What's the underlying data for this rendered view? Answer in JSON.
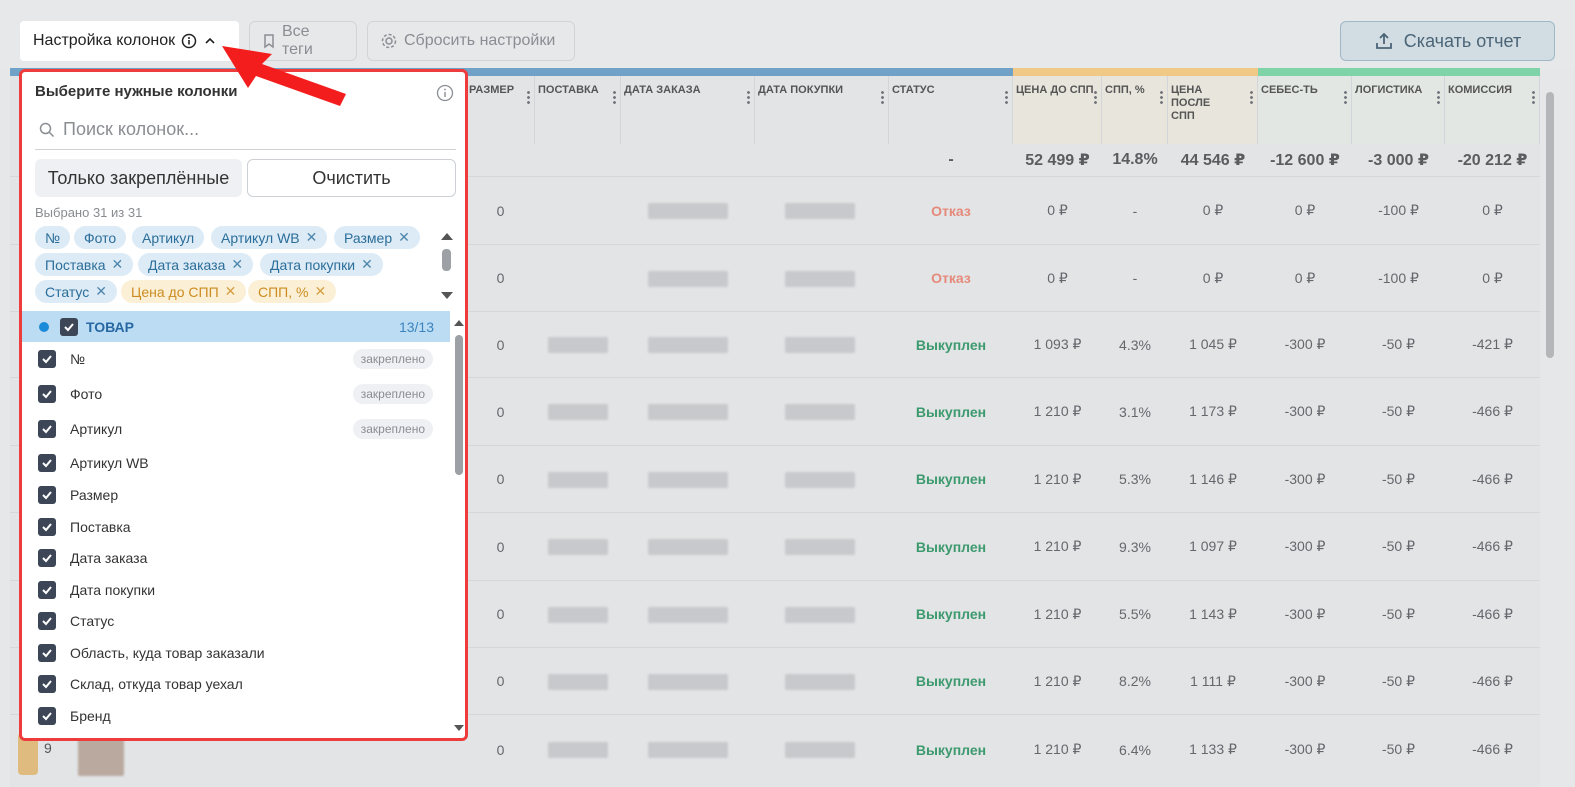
{
  "toolbar": {
    "columns_button": "Настройка колонок",
    "tags_button": "Все теги",
    "reset_button": "Сбросить настройки",
    "download_button": "Скачать отчет"
  },
  "table": {
    "headers": [
      "Размер",
      "Поставка",
      "Дата заказа",
      "Дата покупки",
      "Статус",
      "Цена до СПП",
      "СПП, %",
      "Цена после СПП",
      "Себес-ть",
      "Логистика",
      "Комиссия"
    ],
    "group_colors": {
      "blue": "#6fa2c6",
      "orange": "#f0c987",
      "green": "#7fd3a8"
    },
    "totals": {
      "status": "-",
      "price_before": "52 499 ₽",
      "spp": "14.8%",
      "price_after": "44 546 ₽",
      "cost": "-12 600 ₽",
      "logistics": "-3 000 ₽",
      "commission": "-20 212 ₽"
    },
    "rows": [
      {
        "size": "0",
        "status": "Отказ",
        "status_type": "refuse",
        "price_before": "0 ₽",
        "spp": "-",
        "price_after": "0 ₽",
        "cost": "0 ₽",
        "logistics": "-100 ₽",
        "commission": "0 ₽"
      },
      {
        "size": "0",
        "status": "Отказ",
        "status_type": "refuse",
        "price_before": "0 ₽",
        "spp": "-",
        "price_after": "0 ₽",
        "cost": "0 ₽",
        "logistics": "-100 ₽",
        "commission": "0 ₽"
      },
      {
        "size": "0",
        "status": "Выкуплен",
        "status_type": "bought",
        "price_before": "1 093 ₽",
        "spp": "4.3%",
        "price_after": "1 045 ₽",
        "cost": "-300 ₽",
        "logistics": "-50 ₽",
        "commission": "-421 ₽"
      },
      {
        "size": "0",
        "status": "Выкуплен",
        "status_type": "bought",
        "price_before": "1 210 ₽",
        "spp": "3.1%",
        "price_after": "1 173 ₽",
        "cost": "-300 ₽",
        "logistics": "-50 ₽",
        "commission": "-466 ₽"
      },
      {
        "size": "0",
        "status": "Выкуплен",
        "status_type": "bought",
        "price_before": "1 210 ₽",
        "spp": "5.3%",
        "price_after": "1 146 ₽",
        "cost": "-300 ₽",
        "logistics": "-50 ₽",
        "commission": "-466 ₽"
      },
      {
        "size": "0",
        "status": "Выкуплен",
        "status_type": "bought",
        "price_before": "1 210 ₽",
        "spp": "9.3%",
        "price_after": "1 097 ₽",
        "cost": "-300 ₽",
        "logistics": "-50 ₽",
        "commission": "-466 ₽"
      },
      {
        "size": "0",
        "status": "Выкуплен",
        "status_type": "bought",
        "price_before": "1 210 ₽",
        "spp": "5.5%",
        "price_after": "1 143 ₽",
        "cost": "-300 ₽",
        "logistics": "-50 ₽",
        "commission": "-466 ₽"
      },
      {
        "size": "0",
        "status": "Выкуплен",
        "status_type": "bought",
        "price_before": "1 210 ₽",
        "spp": "8.2%",
        "price_after": "1 111 ₽",
        "cost": "-300 ₽",
        "logistics": "-50 ₽",
        "commission": "-466 ₽"
      },
      {
        "size": "0",
        "status": "Выкуплен",
        "status_type": "bought",
        "price_before": "1 210 ₽",
        "spp": "6.4%",
        "price_after": "1 133 ₽",
        "cost": "-300 ₽",
        "logistics": "-50 ₽",
        "commission": "-466 ₽"
      }
    ],
    "last_row_number": "9"
  },
  "panel": {
    "title": "Выберите нужные колонки",
    "search_placeholder": "Поиск колонок...",
    "pinned_button": "Только закреплённые",
    "clear_button": "Очистить",
    "selected_text": "Выбрано 31 из 31",
    "chips": [
      {
        "label": "№",
        "removable": false,
        "color": "blue"
      },
      {
        "label": "Фото",
        "removable": false,
        "color": "blue"
      },
      {
        "label": "Артикул",
        "removable": false,
        "color": "blue"
      },
      {
        "label": "Артикул WB",
        "removable": true,
        "color": "blue"
      },
      {
        "label": "Размер",
        "removable": true,
        "color": "blue"
      },
      {
        "label": "Поставка",
        "removable": true,
        "color": "blue"
      },
      {
        "label": "Дата заказа",
        "removable": true,
        "color": "blue"
      },
      {
        "label": "Дата покупки",
        "removable": true,
        "color": "blue"
      },
      {
        "label": "Статус",
        "removable": true,
        "color": "blue"
      },
      {
        "label": "Цена до СПП",
        "removable": true,
        "color": "orange"
      },
      {
        "label": "СПП, %",
        "removable": true,
        "color": "orange"
      }
    ],
    "group": {
      "label": "ТОВАР",
      "count": "13/13"
    },
    "items": [
      {
        "label": "№",
        "pinned": "закреплено"
      },
      {
        "label": "Фото",
        "pinned": "закреплено"
      },
      {
        "label": "Артикул",
        "pinned": "закреплено"
      },
      {
        "label": "Артикул WB",
        "pinned": ""
      },
      {
        "label": "Размер",
        "pinned": ""
      },
      {
        "label": "Поставка",
        "pinned": ""
      },
      {
        "label": "Дата заказа",
        "pinned": ""
      },
      {
        "label": "Дата покупки",
        "pinned": ""
      },
      {
        "label": "Статус",
        "pinned": ""
      },
      {
        "label": "Область, куда товар заказали",
        "pinned": ""
      },
      {
        "label": "Склад, откуда товар уехал",
        "pinned": ""
      },
      {
        "label": "Бренд",
        "pinned": ""
      }
    ]
  }
}
